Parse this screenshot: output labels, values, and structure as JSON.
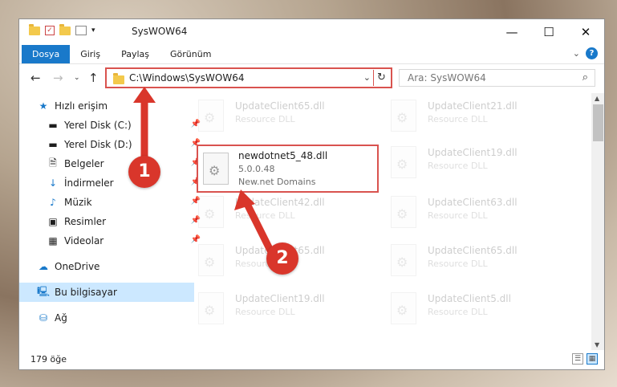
{
  "window": {
    "title": "SysWOW64"
  },
  "ribbon": {
    "tabs": [
      "Dosya",
      "Giriş",
      "Paylaş",
      "Görünüm"
    ]
  },
  "address": {
    "path": "C:\\Windows\\SysWOW64"
  },
  "search": {
    "placeholder": "Ara: SysWOW64"
  },
  "sidebar": {
    "items": [
      {
        "label": "Hızlı erişim",
        "icon": "star-icon",
        "pinned": false
      },
      {
        "label": "Yerel Disk (C:)",
        "icon": "drive-icon",
        "pinned": true
      },
      {
        "label": "Yerel Disk (D:)",
        "icon": "drive-icon",
        "pinned": true
      },
      {
        "label": "Belgeler",
        "icon": "document-icon",
        "pinned": true
      },
      {
        "label": "İndirmeler",
        "icon": "download-icon",
        "pinned": true
      },
      {
        "label": "Müzik",
        "icon": "music-icon",
        "pinned": true
      },
      {
        "label": "Resimler",
        "icon": "pictures-icon",
        "pinned": true
      },
      {
        "label": "Videolar",
        "icon": "video-icon",
        "pinned": true
      },
      {
        "label": "OneDrive",
        "icon": "cloud-icon",
        "pinned": false
      },
      {
        "label": "Bu bilgisayar",
        "icon": "computer-icon",
        "pinned": false,
        "selected": true
      },
      {
        "label": "Ağ",
        "icon": "network-icon",
        "pinned": false
      }
    ]
  },
  "files": [
    {
      "name": "UpdateClient65.dll",
      "desc": "Resource DLL"
    },
    {
      "name": "UpdateClient21.dll",
      "desc": "Resource DLL"
    },
    {
      "name": "newdotnet5_48.dll",
      "version": "5.0.0.48",
      "company": "New.net Domains",
      "highlighted": true
    },
    {
      "name": "UpdateClient19.dll",
      "desc": "Resource DLL"
    },
    {
      "name": "UpdateClient42.dll",
      "desc": "Resource DLL"
    },
    {
      "name": "UpdateClient63.dll",
      "desc": "Resource DLL"
    },
    {
      "name": "UpdateClient65.dll",
      "desc": "Resource DLL"
    },
    {
      "name": "UpdateClient65.dll",
      "desc": "Resource DLL"
    },
    {
      "name": "UpdateClient19.dll",
      "desc": "Resource DLL"
    },
    {
      "name": "UpdateClient5.dll",
      "desc": "Resource DLL"
    }
  ],
  "status": {
    "count": "179 öğe"
  },
  "annotations": [
    "1",
    "2"
  ],
  "colors": {
    "accent": "#1979ca",
    "highlight": "#d9534f",
    "badge": "#d9362b"
  }
}
